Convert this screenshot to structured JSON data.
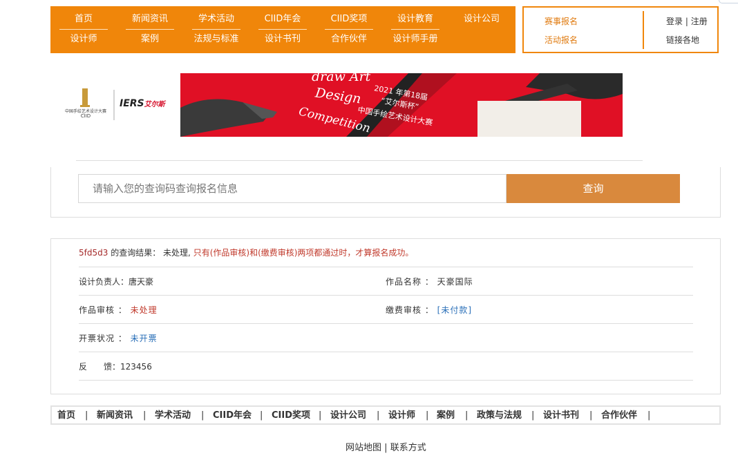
{
  "nav": {
    "row1": [
      "首页",
      "新闻资讯",
      "学术活动",
      "CIID年会",
      "CIID奖项",
      "设计教育",
      "设计公司"
    ],
    "row2": [
      "设计师",
      "案例",
      "法规与标准",
      "设计书刊",
      "合作伙伴",
      "设计师手册"
    ]
  },
  "side": {
    "contest_signup": "赛事报名",
    "event_signup": "活动报名",
    "login": "登录",
    "sep": "|",
    "register": "注册",
    "regions": "链接各地"
  },
  "banner": {
    "logo_caption": "中国手绘艺术设计大赛",
    "logo_ciid": "CIID",
    "sponsor": "IERS",
    "sponsor_cn": "艾尔斯",
    "art_line1": "draw Art",
    "art_line2": "Design",
    "art_line3": "Competition",
    "year_text": "2021 年第18届",
    "cup_text": "“艾尔斯杯”",
    "contest_name": "中国手绘艺术设计大赛"
  },
  "search": {
    "placeholder": "请输入您的查询码查询报名信息",
    "button": "查询"
  },
  "result": {
    "code": "5fd5d3",
    "label": "的查询结果：",
    "status": "未处理,",
    "notice": "只有(作品审核)和(缴费审核)两项都通过时，才算报名成功。",
    "designer_label": "设计负责人：",
    "designer": "唐天豪",
    "work_label": "作品名称 ：",
    "work": "天豪国际",
    "review_label": "作品审核 ：",
    "review": "未处理",
    "fee_label": "缴费审核 ：",
    "fee": "[未付款]",
    "invoice_label": "开票状况 ：",
    "invoice": "未开票",
    "feedback_label": "反　　馈：",
    "feedback": "123456"
  },
  "footer": {
    "items": [
      "首页",
      "新闻资讯",
      "学术活动",
      "CIID年会",
      "CIID奖项",
      "设计公司",
      "设计师",
      "案例",
      "政策与法规",
      "设计书刊",
      "合作伙伴"
    ],
    "sep": "|",
    "sitemap": "网站地图",
    "bottom_sep": "|",
    "contact": "联系方式"
  },
  "colors": {
    "brand_orange": "#f0860a",
    "button_orange": "#d9893d",
    "alert_red": "#c0392b",
    "link_blue": "#2a6fb8"
  }
}
